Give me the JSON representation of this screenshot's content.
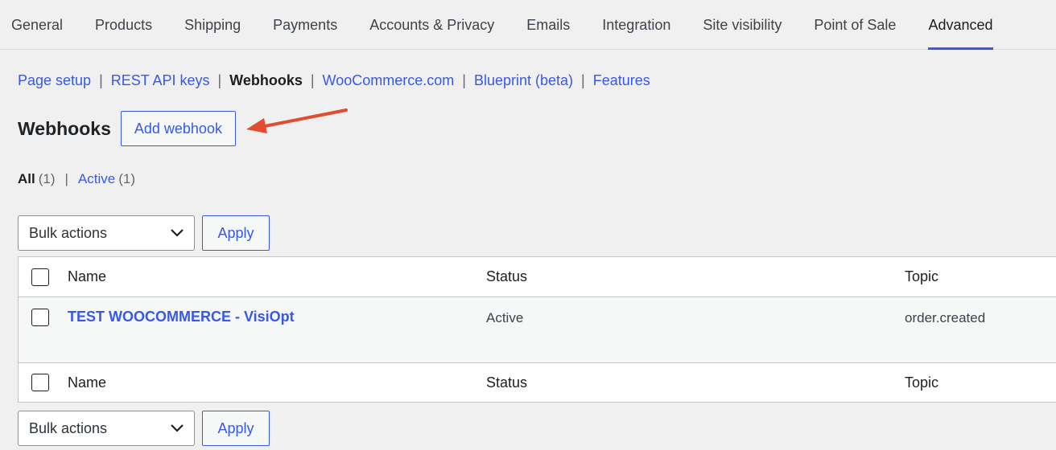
{
  "tabs": [
    "General",
    "Products",
    "Shipping",
    "Payments",
    "Accounts & Privacy",
    "Emails",
    "Integration",
    "Site visibility",
    "Point of Sale",
    "Advanced"
  ],
  "active_tab": "Advanced",
  "subnav": {
    "page_setup": "Page setup",
    "rest_api_keys": "REST API keys",
    "webhooks": "Webhooks",
    "woocommerce_com": "WooCommerce.com",
    "blueprint": "Blueprint (beta)",
    "features": "Features",
    "separator": "|"
  },
  "heading": {
    "title": "Webhooks",
    "add_button": "Add webhook"
  },
  "filters": {
    "all_label": "All",
    "all_count": "(1)",
    "active_label": "Active",
    "active_count": "(1)",
    "separator": "|"
  },
  "bulk": {
    "select_value": "Bulk actions",
    "apply_label": "Apply"
  },
  "table": {
    "columns": {
      "name": "Name",
      "status": "Status",
      "topic": "Topic"
    },
    "rows": [
      {
        "name": "TEST WOOCOMMERCE - VisiOpt",
        "status": "Active",
        "topic": "order.created"
      }
    ]
  },
  "colors": {
    "accent": "#3858e9",
    "annotation_arrow": "#e34c2e"
  }
}
